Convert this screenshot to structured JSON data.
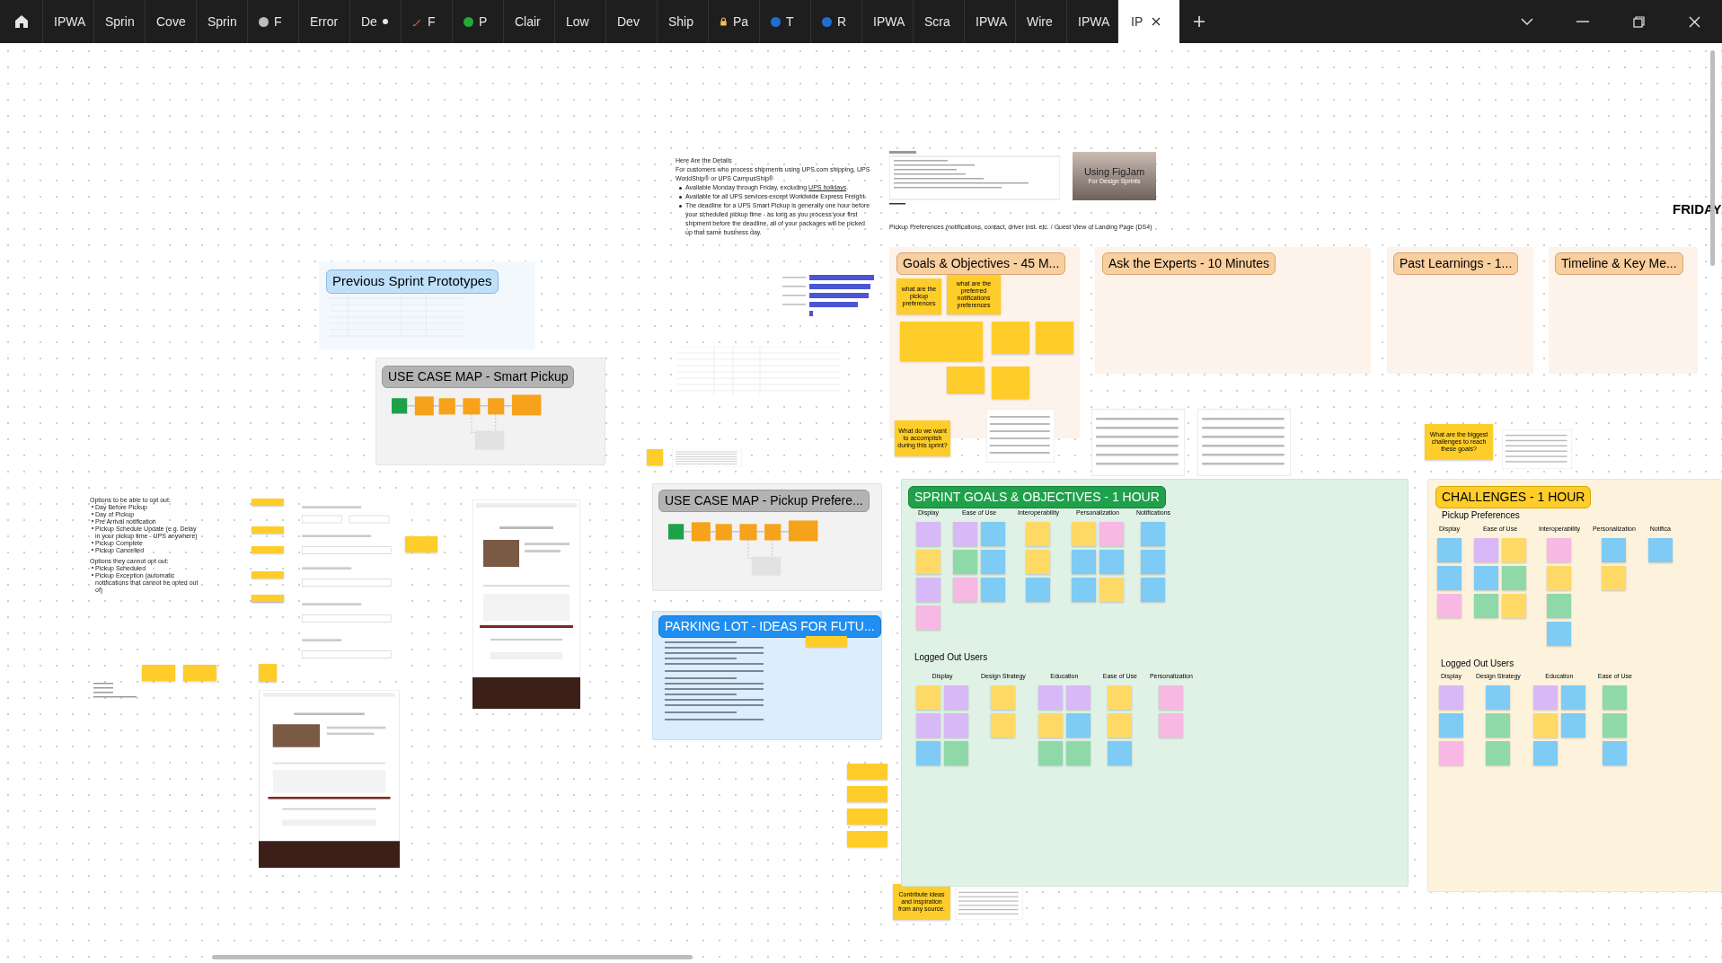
{
  "tabs": [
    {
      "label": "IPWA",
      "kind": "plain",
      "selected": false
    },
    {
      "label": "Sprin",
      "kind": "plain",
      "selected": false
    },
    {
      "label": "Cove",
      "kind": "plain",
      "selected": false
    },
    {
      "label": "Sprin",
      "kind": "plain",
      "selected": false
    },
    {
      "label": "F",
      "kind": "circle",
      "color": "#bdbdbd",
      "selected": false
    },
    {
      "label": "Error",
      "kind": "plain",
      "selected": false
    },
    {
      "label": "De",
      "kind": "dot",
      "selected": false
    },
    {
      "label": "F",
      "kind": "pencil",
      "selected": false
    },
    {
      "label": "P",
      "kind": "circle",
      "color": "#22a93a",
      "selected": false
    },
    {
      "label": "Clair",
      "kind": "plain",
      "selected": false
    },
    {
      "label": "Low",
      "kind": "plain",
      "selected": false
    },
    {
      "label": "Dev",
      "kind": "plain",
      "selected": false
    },
    {
      "label": "Ship",
      "kind": "plain",
      "selected": false
    },
    {
      "label": "Pa",
      "kind": "lock",
      "selected": false
    },
    {
      "label": "T",
      "kind": "circle",
      "color": "#1e6fd0",
      "selected": false
    },
    {
      "label": "R",
      "kind": "circle",
      "color": "#1e6fd0",
      "selected": false
    },
    {
      "label": "IPWA",
      "kind": "plain",
      "selected": false
    },
    {
      "label": "Scra",
      "kind": "plain",
      "selected": false
    },
    {
      "label": "IPWA",
      "kind": "plain",
      "selected": false
    },
    {
      "label": "Wire",
      "kind": "plain",
      "selected": false
    },
    {
      "label": "IPWA",
      "kind": "plain",
      "selected": false
    },
    {
      "label": "IP",
      "kind": "plain",
      "selected": true
    }
  ],
  "details": {
    "title": "Here Are the Details",
    "intro": "For customers who process shipments using UPS.com shipping, UPS WorldShip® or UPS CampusShip®",
    "bullets": [
      {
        "text": "Available Monday through Friday, excluding ",
        "link": "UPS holidays",
        "after": "."
      },
      {
        "text": "Available for all UPS services except Worldwide Express Freight."
      },
      {
        "text": "The deadline for a UPS Smart Pickup is generally one hour before your scheduled pickup time - as long as you process your first shipment before the deadline, all of your packages will be picked up that same business day."
      }
    ]
  },
  "opt_out": {
    "title": "Options to be able to opt out:",
    "items": [
      "Day Before Pickup",
      "Day of Pickup",
      "Pre Arrival notification",
      "Pickup Schedule Update (e.g. Delay in your pickup time - UPS anywhere)",
      "Pickup Complete",
      "Pickup Cancelled"
    ],
    "title_2": "Options they cannot opt out:",
    "items_2": [
      "Pickup Scheduled",
      "Pickup Exception (automatic notifications that cannot be opted out of)"
    ]
  },
  "thumbnail": {
    "title": "Using FigJam",
    "subtitle": "For Design Sprints"
  },
  "pickup_heading": "Pickup Preferences (notifications, contact, driver inst. etc. / Guest View of Landing Page (DS4)",
  "friday": "FRIDAY",
  "sections": {
    "previous": "Previous Sprint Prototypes",
    "use_case_1": "USE CASE MAP - Smart Pickup",
    "use_case_2": "USE CASE MAP - Pickup Prefere...",
    "parking": "PARKING LOT - IDEAS FOR FUTU...",
    "goals": "Goals & Objectives - 45 M...",
    "experts": "Ask the Experts - 10 Minutes",
    "past": "Past Learnings - 1...",
    "timeline": "Timeline & Key Me..."
  },
  "goal_stickies": [
    "what are the pickup preferences",
    "what are the preferred notifications preferences"
  ],
  "prompts": {
    "accomplish": "What do we want to accomplish during this sprint?",
    "challenges": "What are the biggest challenges to reach these goals?",
    "contribute": "Contribute ideas and inspiration from any source."
  },
  "sprint_goals": {
    "title": "SPRINT GOALS & OBJECTIVES - 1 HOUR",
    "groups": [
      {
        "name": "Display",
        "stickies": [
          {
            "color": "#d9b8f7"
          },
          {
            "color": "#ffd966"
          },
          {
            "color": "#d9b8f7"
          },
          {
            "color": "#f7b8e4"
          }
        ]
      },
      {
        "name": "Ease of Use",
        "stickies": [
          {
            "color": "#d9b8f7"
          },
          {
            "color": "#7ecbf5"
          },
          {
            "color": "#8fd9a8"
          },
          {
            "color": "#7ecbf5"
          },
          {
            "color": "#f7b8e4"
          },
          {
            "color": "#7ecbf5"
          }
        ]
      },
      {
        "name": "Interoperability",
        "stickies": [
          {
            "color": "#ffd966"
          },
          {
            "color": "#ffd966"
          },
          {
            "color": "#7ecbf5"
          }
        ]
      },
      {
        "name": "Personalization",
        "stickies": [
          {
            "color": "#ffd966"
          },
          {
            "color": "#f7b8e4"
          },
          {
            "color": "#7ecbf5"
          },
          {
            "color": "#7ecbf5"
          },
          {
            "color": "#7ecbf5"
          },
          {
            "color": "#ffd966"
          }
        ]
      },
      {
        "name": "Notifications",
        "stickies": [
          {
            "color": "#7ecbf5"
          },
          {
            "color": "#7ecbf5"
          },
          {
            "color": "#7ecbf5"
          }
        ]
      }
    ],
    "subtitle": "Logged Out Users",
    "groups_2": [
      {
        "name": "Display",
        "stickies": [
          {
            "color": "#ffd966"
          },
          {
            "color": "#d9b8f7"
          },
          {
            "color": "#d9b8f7"
          },
          {
            "color": "#d9b8f7"
          },
          {
            "color": "#7ecbf5"
          },
          {
            "color": "#8fd9a8"
          }
        ]
      },
      {
        "name": "Design Strategy",
        "stickies": [
          {
            "color": "#ffd966"
          },
          {
            "color": "#ffd966"
          }
        ]
      },
      {
        "name": "Education",
        "stickies": [
          {
            "color": "#d9b8f7"
          },
          {
            "color": "#d9b8f7"
          },
          {
            "color": "#ffd966"
          },
          {
            "color": "#7ecbf5"
          },
          {
            "color": "#8fd9a8"
          },
          {
            "color": "#8fd9a8"
          }
        ]
      },
      {
        "name": "Ease of Use",
        "stickies": [
          {
            "color": "#ffd966"
          },
          {
            "color": "#ffd966"
          },
          {
            "color": "#7ecbf5"
          }
        ]
      },
      {
        "name": "Personalization",
        "stickies": [
          {
            "color": "#f7b8e4"
          },
          {
            "color": "#f7b8e4"
          }
        ]
      }
    ]
  },
  "challenges": {
    "title": "CHALLENGES - 1 HOUR",
    "subtitle": "Pickup Preferences",
    "groups": [
      {
        "name": "Display",
        "stickies": [
          {
            "color": "#7ecbf5"
          },
          {
            "color": "#7ecbf5"
          },
          {
            "color": "#f7b8e4"
          }
        ]
      },
      {
        "name": "Ease of Use",
        "stickies": [
          {
            "color": "#d9b8f7"
          },
          {
            "color": "#ffd966"
          },
          {
            "color": "#7ecbf5"
          },
          {
            "color": "#8fd9a8"
          },
          {
            "color": "#8fd9a8"
          },
          {
            "color": "#ffd966"
          }
        ]
      },
      {
        "name": "Interoperability",
        "stickies": [
          {
            "color": "#f7b8e4"
          },
          {
            "color": "#ffd966"
          },
          {
            "color": "#8fd9a8"
          },
          {
            "color": "#7ecbf5"
          }
        ]
      },
      {
        "name": "Personalization",
        "stickies": [
          {
            "color": "#7ecbf5"
          },
          {
            "color": "#ffd966"
          }
        ]
      },
      {
        "name": "Notifica",
        "stickies": [
          {
            "color": "#7ecbf5"
          }
        ]
      }
    ],
    "subtitle_2": "Logged Out Users",
    "groups_2": [
      {
        "name": "Display",
        "stickies": [
          {
            "color": "#d9b8f7"
          },
          {
            "color": "#7ecbf5"
          },
          {
            "color": "#f7b8e4"
          }
        ]
      },
      {
        "name": "Design Strategy",
        "stickies": [
          {
            "color": "#7ecbf5"
          },
          {
            "color": "#8fd9a8"
          },
          {
            "color": "#8fd9a8"
          }
        ]
      },
      {
        "name": "Education",
        "stickies": [
          {
            "color": "#d9b8f7"
          },
          {
            "color": "#7ecbf5"
          },
          {
            "color": "#ffd966"
          },
          {
            "color": "#7ecbf5"
          },
          {
            "color": "#7ecbf5"
          }
        ]
      },
      {
        "name": "Ease of Use",
        "stickies": [
          {
            "color": "#8fd9a8"
          },
          {
            "color": "#8fd9a8"
          },
          {
            "color": "#7ecbf5"
          }
        ]
      }
    ]
  }
}
